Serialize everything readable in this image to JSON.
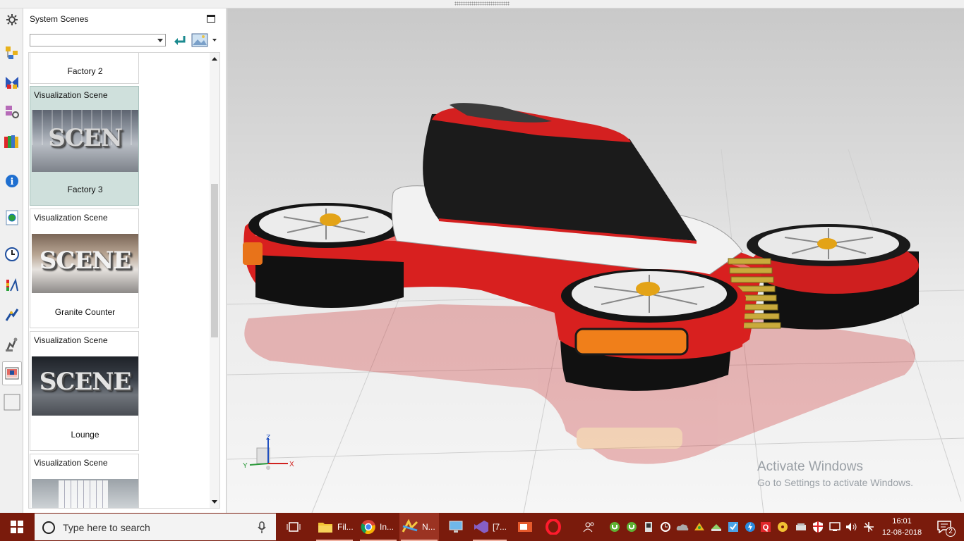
{
  "panel": {
    "title": "System Scenes",
    "combo_value": "",
    "apply_icon": "apply-arrow-icon",
    "background_icon": "background-picture-icon"
  },
  "scenes": [
    {
      "category": "",
      "name": "Factory 2",
      "thumb_text": ""
    },
    {
      "category": "Visualization Scene",
      "name": "Factory 3",
      "thumb_text": "SCEN",
      "selected": true
    },
    {
      "category": "Visualization Scene",
      "name": "Granite Counter",
      "thumb_text": "SCENE"
    },
    {
      "category": "Visualization Scene",
      "name": "Lounge",
      "thumb_text": "SCENE"
    },
    {
      "category": "Visualization Scene",
      "name": "",
      "thumb_text": ""
    }
  ],
  "triad": {
    "x": "X",
    "y": "Y",
    "z": "Z"
  },
  "watermark": {
    "line1": "Activate Windows",
    "line2": "Go to Settings to activate Windows."
  },
  "taskbar": {
    "search_placeholder": "Type here to search",
    "apps": [
      {
        "label": "Fil...",
        "icon": "file-explorer-icon"
      },
      {
        "label": "In...",
        "icon": "chrome-icon"
      },
      {
        "label": "N...",
        "icon": "nx-icon"
      },
      {
        "label": "",
        "icon": "computer-icon"
      },
      {
        "label": "[7...",
        "icon": "visual-studio-icon"
      },
      {
        "label": "",
        "icon": "presentation-icon"
      },
      {
        "label": "",
        "icon": "opera-icon"
      }
    ],
    "clock_time": "16:01",
    "clock_date": "12-08-2018",
    "notification_count": "2"
  },
  "colors": {
    "taskbar": "#7a1b0c",
    "selected_card": "#cfe0dc",
    "drone_red": "#d8201f"
  }
}
